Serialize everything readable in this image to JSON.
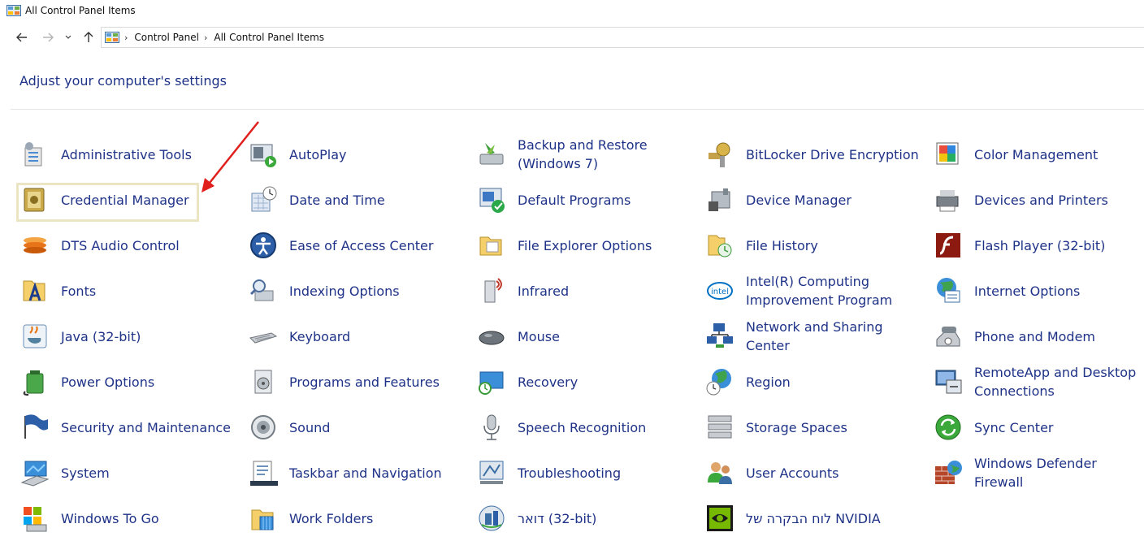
{
  "window": {
    "title": "All Control Panel Items"
  },
  "breadcrumb": [
    "Control Panel",
    "All Control Panel Items"
  ],
  "heading": "Adjust your computer's settings",
  "items": [
    {
      "label": "Administrative Tools",
      "icon": "admin-tools-icon"
    },
    {
      "label": "AutoPlay",
      "icon": "autoplay-icon"
    },
    {
      "label": "Backup and Restore\n(Windows 7)",
      "icon": "backup-restore-icon"
    },
    {
      "label": "BitLocker Drive Encryption",
      "icon": "bitlocker-icon"
    },
    {
      "label": "Color Management",
      "icon": "color-management-icon"
    },
    {
      "label": "Credential Manager",
      "icon": "credential-manager-icon"
    },
    {
      "label": "Date and Time",
      "icon": "date-time-icon"
    },
    {
      "label": "Default Programs",
      "icon": "default-programs-icon"
    },
    {
      "label": "Device Manager",
      "icon": "device-manager-icon"
    },
    {
      "label": "Devices and Printers",
      "icon": "devices-printers-icon"
    },
    {
      "label": "DTS Audio Control",
      "icon": "dts-audio-icon"
    },
    {
      "label": "Ease of Access Center",
      "icon": "ease-of-access-icon"
    },
    {
      "label": "File Explorer Options",
      "icon": "file-explorer-options-icon"
    },
    {
      "label": "File History",
      "icon": "file-history-icon"
    },
    {
      "label": "Flash Player (32-bit)",
      "icon": "flash-player-icon"
    },
    {
      "label": "Fonts",
      "icon": "fonts-icon"
    },
    {
      "label": "Indexing Options",
      "icon": "indexing-options-icon"
    },
    {
      "label": "Infrared",
      "icon": "infrared-icon"
    },
    {
      "label": "Intel(R) Computing\nImprovement Program",
      "icon": "intel-icon"
    },
    {
      "label": "Internet Options",
      "icon": "internet-options-icon"
    },
    {
      "label": "Java (32-bit)",
      "icon": "java-icon"
    },
    {
      "label": "Keyboard",
      "icon": "keyboard-icon"
    },
    {
      "label": "Mouse",
      "icon": "mouse-icon"
    },
    {
      "label": "Network and Sharing\nCenter",
      "icon": "network-sharing-icon"
    },
    {
      "label": "Phone and Modem",
      "icon": "phone-modem-icon"
    },
    {
      "label": "Power Options",
      "icon": "power-options-icon"
    },
    {
      "label": "Programs and Features",
      "icon": "programs-features-icon"
    },
    {
      "label": "Recovery",
      "icon": "recovery-icon"
    },
    {
      "label": "Region",
      "icon": "region-icon"
    },
    {
      "label": "RemoteApp and Desktop\nConnections",
      "icon": "remoteapp-icon"
    },
    {
      "label": "Security and Maintenance",
      "icon": "security-maintenance-icon"
    },
    {
      "label": "Sound",
      "icon": "sound-icon"
    },
    {
      "label": "Speech Recognition",
      "icon": "speech-recognition-icon"
    },
    {
      "label": "Storage Spaces",
      "icon": "storage-spaces-icon"
    },
    {
      "label": "Sync Center",
      "icon": "sync-center-icon"
    },
    {
      "label": "System",
      "icon": "system-icon"
    },
    {
      "label": "Taskbar and Navigation",
      "icon": "taskbar-navigation-icon"
    },
    {
      "label": "Troubleshooting",
      "icon": "troubleshooting-icon"
    },
    {
      "label": "User Accounts",
      "icon": "user-accounts-icon"
    },
    {
      "label": "Windows Defender\nFirewall",
      "icon": "firewall-icon"
    },
    {
      "label": "Windows To Go",
      "icon": "windows-to-go-icon"
    },
    {
      "label": "Work Folders",
      "icon": "work-folders-icon"
    },
    {
      "label": "דואר (32-bit)",
      "icon": "mail-icon"
    },
    {
      "label": "לוח הבקרה של NVIDIA",
      "icon": "nvidia-icon"
    }
  ]
}
